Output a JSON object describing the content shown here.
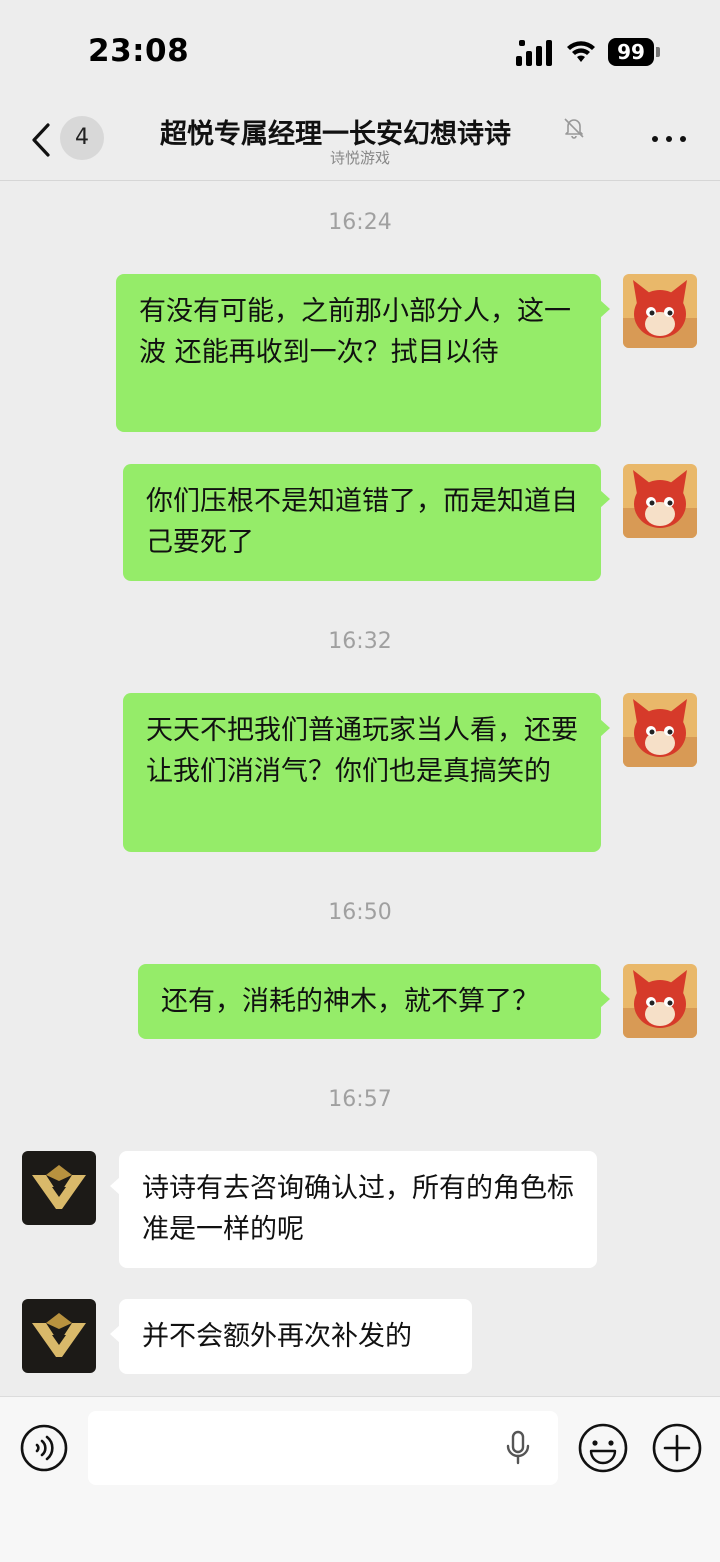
{
  "status_bar": {
    "time": "23:08",
    "battery": "99"
  },
  "nav": {
    "unread_count": "4",
    "title": "超悦专属经理一长安幻想诗诗",
    "subtitle": "诗悦游戏"
  },
  "messages": [
    {
      "type": "time",
      "text": "16:24"
    },
    {
      "type": "out",
      "text": "有没有可能，之前那小部分人，这一波 还能再收到一次？拭目以待"
    },
    {
      "type": "out",
      "text": "你们压根不是知道错了，而是知道自己要死了"
    },
    {
      "type": "time",
      "text": "16:32"
    },
    {
      "type": "out",
      "text": "天天不把我们普通玩家当人看，还要让我们消消气？你们也是真搞笑的"
    },
    {
      "type": "time",
      "text": "16:50"
    },
    {
      "type": "out",
      "text": "还有，消耗的神木，就不算了？"
    },
    {
      "type": "time",
      "text": "16:57"
    },
    {
      "type": "in",
      "text": "诗诗有去咨询确认过，所有的角色标准是一样的呢"
    },
    {
      "type": "in",
      "text": "并不会额外再次补发的"
    }
  ],
  "input": {
    "placeholder": ""
  },
  "icons": {
    "back": "chevron-left-icon",
    "mute": "bell-off-icon",
    "more": "more-dots-icon",
    "voice": "voice-icon",
    "mic": "microphone-icon",
    "emoji": "emoji-icon",
    "plus": "plus-icon"
  },
  "colors": {
    "background": "#ededed",
    "outgoing_bubble": "#95ec69",
    "incoming_bubble": "#ffffff",
    "timestamp": "#a0a0a0"
  }
}
